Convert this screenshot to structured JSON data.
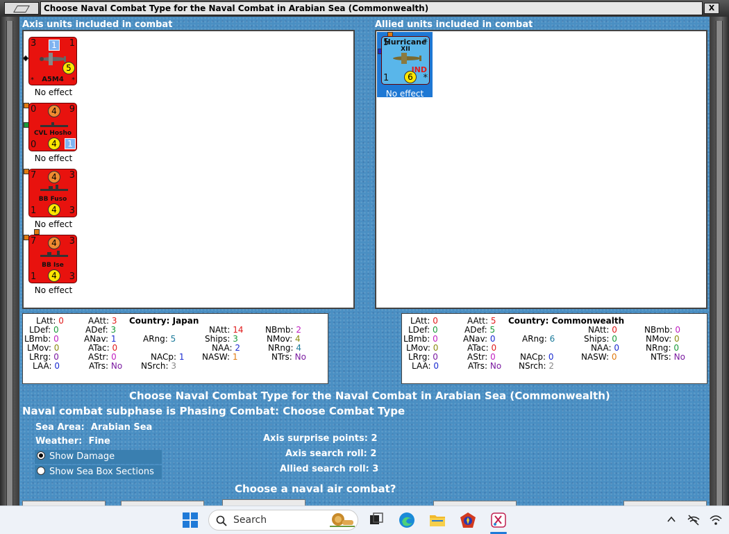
{
  "window": {
    "title": "Choose Naval Combat Type for the Naval Combat in Arabian Sea (Commonwealth)",
    "close_glyph": "X"
  },
  "axis": {
    "header": "Axis units included in combat",
    "units": [
      {
        "name": "A5M4",
        "tl": "3",
        "tr": "1",
        "top_box": "1",
        "circle": "5",
        "bl": "*",
        "br": "*",
        "effect": "No effect",
        "type": "plane"
      },
      {
        "name": "CVL Hosho",
        "tl": "0",
        "tr": "9",
        "top_circle": "4",
        "bl": "0",
        "circle": "4",
        "br_box": "1",
        "effect": "No effect",
        "type": "ship"
      },
      {
        "name": "BB Fuso",
        "tl": "7",
        "tr": "3",
        "top_circle": "4",
        "bl": "1",
        "circle": "4",
        "br": "3",
        "effect": "No effect",
        "type": "ship"
      },
      {
        "name": "BB Ise",
        "tl": "7",
        "tr": "3",
        "top_circle": "4",
        "bl": "1",
        "circle": "4",
        "br": "3",
        "effect": "No effect",
        "type": "ship"
      }
    ],
    "stats": {
      "country_label": "Country:",
      "country": "Japan",
      "LAtt": "0",
      "AAtt": "3",
      "LDef": "0",
      "ADef": "3",
      "LBmb": "0",
      "ANav": "1",
      "LMov": "0",
      "ATac": "0",
      "LRrg": "0",
      "AStr": "0",
      "LAA": "0",
      "ATrs": "No",
      "ARng": "5",
      "NACp": "1",
      "NSrch": "3",
      "NAtt": "14",
      "Ships": "3",
      "NAA": "2",
      "NASW": "1",
      "NBmb": "2",
      "NMov": "4",
      "NRng": "4",
      "NTrs": "No"
    }
  },
  "allied": {
    "header": "Allied units included in combat",
    "units": [
      {
        "name": "Hurricane",
        "sub": "XII",
        "tl": "5",
        "tr": "*",
        "nation": "IND",
        "bl": "1",
        "circle": "6",
        "br": "*",
        "effect": "No effect"
      }
    ],
    "stats": {
      "country_label": "Country:",
      "country": "Commonwealth",
      "LAtt": "0",
      "AAtt": "5",
      "LDef": "0",
      "ADef": "5",
      "LBmb": "0",
      "ANav": "0",
      "LMov": "0",
      "ATac": "0",
      "LRrg": "0",
      "AStr": "0",
      "LAA": "0",
      "ATrs": "No",
      "ARng": "6",
      "NACp": "0",
      "NSrch": "2",
      "NAtt": "0",
      "Ships": "0",
      "NAA": "0",
      "NASW": "0",
      "NBmb": "0",
      "NMov": "0",
      "NRng": "0",
      "NTrs": "No"
    }
  },
  "dialog": {
    "title": "Choose Naval Combat Type for the Naval Combat in Arabian Sea (Commonwealth)",
    "subphase": "Naval combat subphase is Phasing Combat: Choose Combat Type",
    "sea_area_label": "Sea Area:",
    "sea_area": "Arabian Sea",
    "weather_label": "Weather:",
    "weather": "Fine",
    "show_damage": "Show Damage",
    "show_sea_box": "Show Sea Box Sections",
    "axis_surprise_label": "Axis surprise points:",
    "axis_surprise": "2",
    "axis_search_label": "Axis search roll:",
    "axis_search": "2",
    "allied_search_label": "Allied search roll:",
    "allied_search": "3",
    "question": "Choose a naval air combat?"
  },
  "taskbar": {
    "search_label": "Search"
  },
  "colors": {
    "red": "#e01b1b",
    "green": "#1a9a3a",
    "blue": "#1a2bd0",
    "magenta": "#c020c0",
    "olive": "#8a8a10",
    "orange": "#e07a10",
    "purple": "#7a1aa0",
    "gray": "#888888"
  }
}
